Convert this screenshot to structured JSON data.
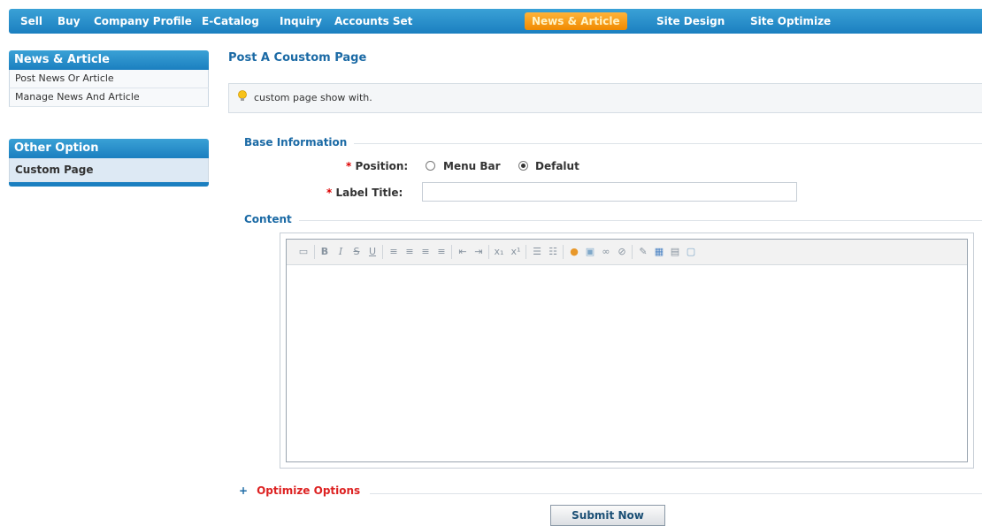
{
  "nav": {
    "items": [
      {
        "label": "Sell"
      },
      {
        "label": "Buy"
      },
      {
        "label": "Company Profile"
      },
      {
        "label": "E-Catalog"
      },
      {
        "label": "Inquiry"
      },
      {
        "label": "Accounts Set"
      },
      {
        "label": "News & Article",
        "active": true
      },
      {
        "label": "Site Design"
      },
      {
        "label": "Site Optimize"
      }
    ]
  },
  "sidebar": {
    "news": {
      "title": "News & Article",
      "items": [
        {
          "label": "Post News Or Article"
        },
        {
          "label": "Manage News And Article"
        }
      ]
    },
    "other": {
      "title": "Other Option",
      "items": [
        {
          "label": "Custom Page",
          "selected": true
        }
      ]
    }
  },
  "main": {
    "title": "Post A Coustom Page",
    "tip": "custom page show with.",
    "base_section": "Base Information",
    "position": {
      "required_mark": "*",
      "label": "Position:",
      "options": [
        {
          "label": "Menu Bar",
          "checked": false
        },
        {
          "label": "Defalut",
          "checked": true
        }
      ]
    },
    "label_title": {
      "required_mark": "*",
      "label": "Label Title:",
      "value": ""
    },
    "content_section": "Content",
    "editor": {
      "tools": [
        "source-icon",
        "bold-icon",
        "italic-icon",
        "strikethrough-icon",
        "underline-icon",
        "align-left-icon",
        "align-center-icon",
        "align-right-icon",
        "align-justify-icon",
        "outdent-icon",
        "indent-icon",
        "subscript-icon",
        "superscript-icon",
        "unordered-list-icon",
        "ordered-list-icon",
        "color-icon",
        "image-icon",
        "link-icon",
        "unlink-icon",
        "spellcheck-icon",
        "table-icon",
        "trash-icon",
        "fullscreen-icon"
      ]
    },
    "optimize": {
      "marker": "+",
      "label": "Optimize Options"
    },
    "submit_label": "Submit Now"
  },
  "colors": {
    "nav_bg": "#1b7fc0",
    "nav_active": "#f39a12",
    "title_blue": "#1b6aa5",
    "required_red": "#d00000",
    "optimize_red": "#d22222"
  }
}
